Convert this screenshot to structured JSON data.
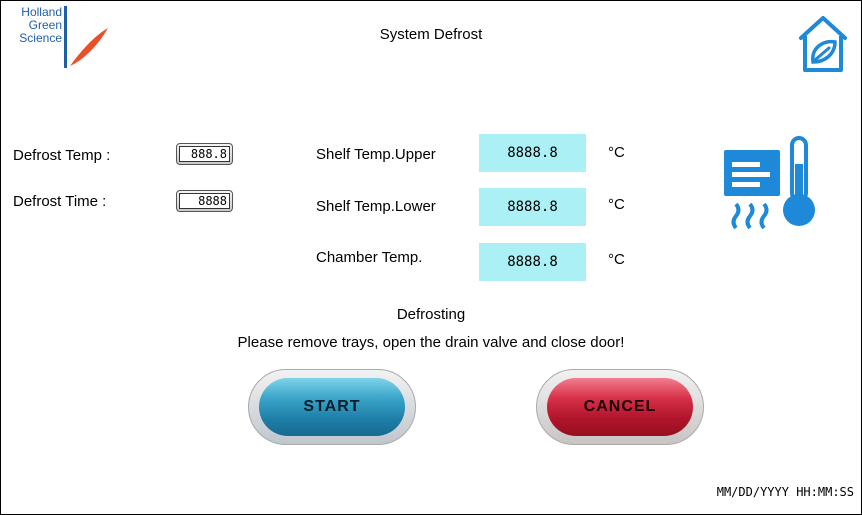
{
  "header": {
    "logo_lines": [
      "Holland",
      "Green",
      "Science"
    ],
    "title": "System Defrost"
  },
  "settings": {
    "defrost_temp": {
      "label": "Defrost Temp :",
      "value": "888.8"
    },
    "defrost_time": {
      "label": "Defrost Time :",
      "value": "8888"
    }
  },
  "readings": [
    {
      "label": "Shelf Temp.Upper",
      "value": "8888.8",
      "unit": "°C"
    },
    {
      "label": "Shelf Temp.Lower",
      "value": "8888.8",
      "unit": "°C"
    },
    {
      "label": "Chamber Temp.",
      "value": "8888.8",
      "unit": "°C"
    }
  ],
  "status": {
    "state": "Defrosting",
    "instruction": "Please remove trays, open the drain valve and close door!"
  },
  "buttons": {
    "start": "START",
    "cancel": "CANCEL"
  },
  "datetime": "MM/DD/YYYY HH:MM:SS",
  "icons": {
    "home": "home-leaf-icon",
    "defrost": "defrost-thermometer-icon"
  },
  "colors": {
    "accent_blue": "#1e88d9",
    "readout_bg": "#aaf0f4",
    "start": "#2a92bd",
    "cancel": "#c91d37"
  }
}
